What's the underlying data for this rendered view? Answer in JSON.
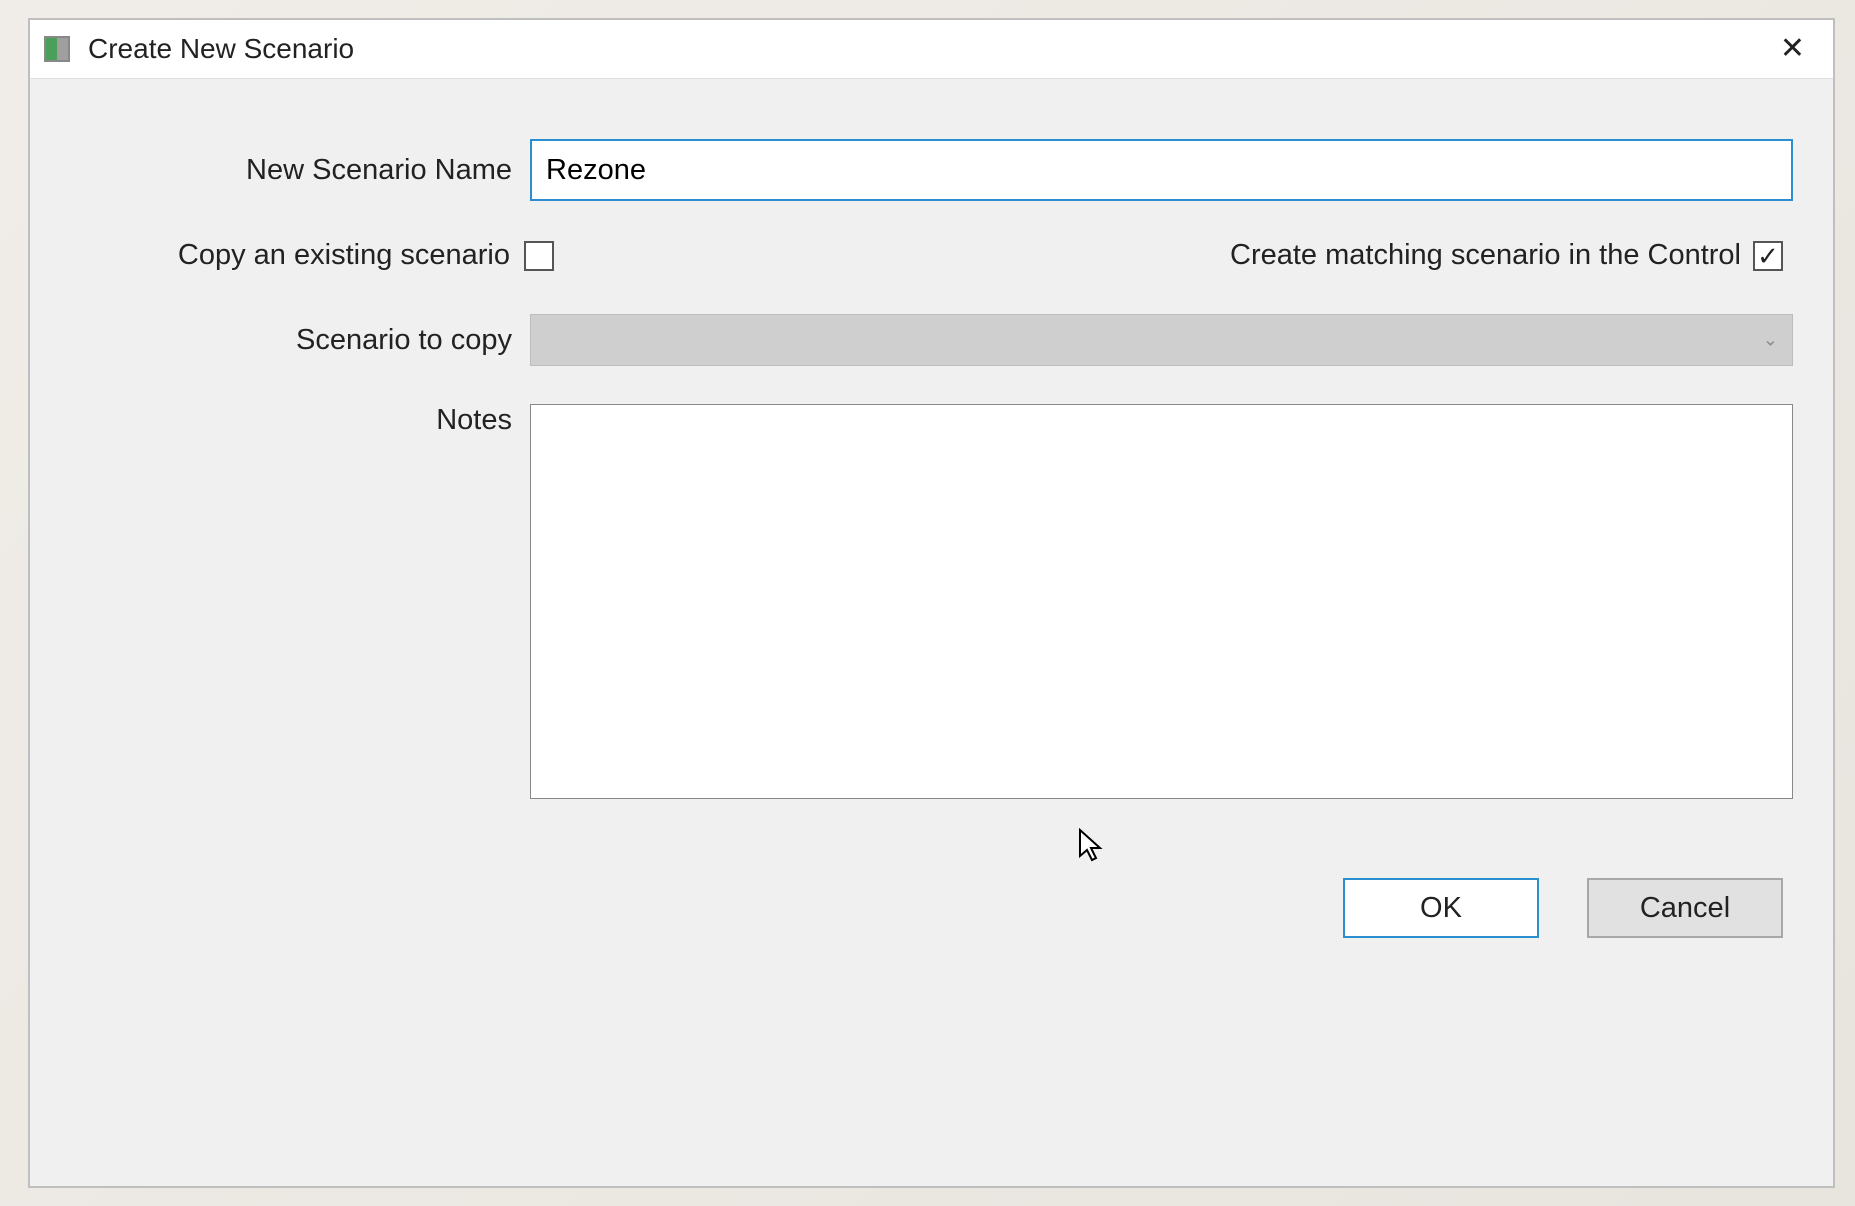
{
  "dialog": {
    "title": "Create New Scenario",
    "labels": {
      "new_scenario_name": "New Scenario Name",
      "copy_existing": "Copy an existing scenario",
      "create_matching": "Create matching scenario in the Control",
      "scenario_to_copy": "Scenario to copy",
      "notes": "Notes"
    },
    "fields": {
      "new_scenario_name_value": "Rezone",
      "copy_existing_checked": false,
      "create_matching_checked": true,
      "scenario_to_copy_value": "",
      "scenario_to_copy_enabled": false,
      "notes_value": ""
    },
    "buttons": {
      "ok": "OK",
      "cancel": "Cancel"
    }
  }
}
